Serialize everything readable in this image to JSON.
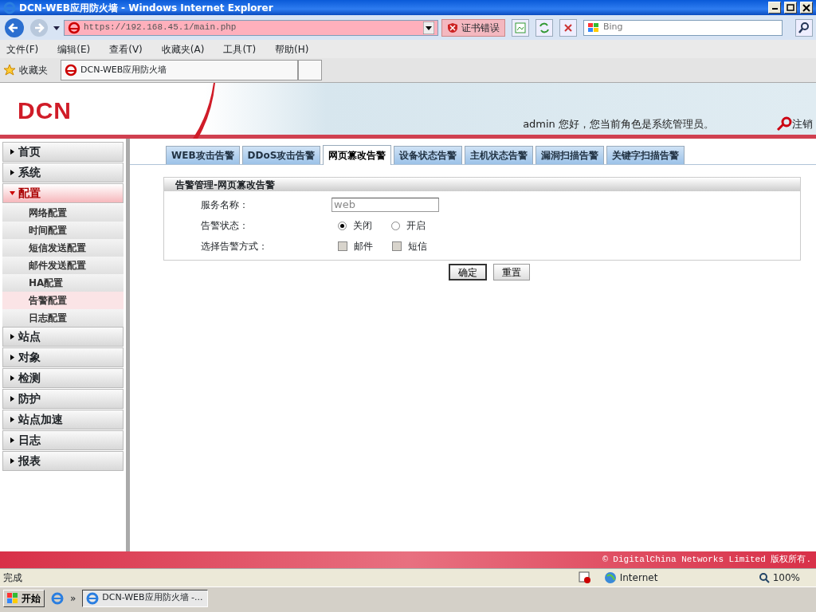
{
  "window": {
    "title": "DCN-WEB应用防火墙 - Windows Internet Explorer"
  },
  "browser": {
    "address": "https://192.168.45.1/main.php",
    "cert_error": "证书错误",
    "search": {
      "placeholder": "Bing"
    },
    "menu": [
      "文件(F)",
      "编辑(E)",
      "查看(V)",
      "收藏夹(A)",
      "工具(T)",
      "帮助(H)"
    ],
    "favorites": "收藏夹",
    "tab": "DCN-WEB应用防火墙"
  },
  "header": {
    "logo": "DCN",
    "greeting": "admin 您好，您当前角色是系统管理员。",
    "logout": "注销"
  },
  "sidebar": {
    "items": [
      {
        "label": "首页",
        "expanded": false
      },
      {
        "label": "系统",
        "expanded": false
      },
      {
        "label": "配置",
        "expanded": true,
        "children": [
          {
            "label": "网络配置",
            "selected": false
          },
          {
            "label": "时间配置",
            "selected": false
          },
          {
            "label": "短信发送配置",
            "selected": false
          },
          {
            "label": "邮件发送配置",
            "selected": false
          },
          {
            "label": "HA配置",
            "selected": false
          },
          {
            "label": "告警配置",
            "selected": true
          },
          {
            "label": "日志配置",
            "selected": false
          }
        ]
      },
      {
        "label": "站点",
        "expanded": false
      },
      {
        "label": "对象",
        "expanded": false
      },
      {
        "label": "检测",
        "expanded": false
      },
      {
        "label": "防护",
        "expanded": false
      },
      {
        "label": "站点加速",
        "expanded": false
      },
      {
        "label": "日志",
        "expanded": false
      },
      {
        "label": "报表",
        "expanded": false
      }
    ]
  },
  "tabs": [
    {
      "label": "WEB攻击告警",
      "selected": false
    },
    {
      "label": "DDoS攻击告警",
      "selected": false
    },
    {
      "label": "网页篡改告警",
      "selected": true
    },
    {
      "label": "设备状态告警",
      "selected": false
    },
    {
      "label": "主机状态告警",
      "selected": false
    },
    {
      "label": "漏洞扫描告警",
      "selected": false
    },
    {
      "label": "关键字扫描告警",
      "selected": false
    }
  ],
  "form": {
    "title": "告警管理-网页篡改告警",
    "fields": [
      {
        "kind": "text",
        "label": "服务名称：",
        "value": "web"
      },
      {
        "kind": "radio",
        "label": "告警状态：",
        "options": [
          {
            "label": "关闭",
            "selected": true
          },
          {
            "label": "开启",
            "selected": false
          }
        ]
      },
      {
        "kind": "checkbox",
        "label": "选择告警方式：",
        "options": [
          {
            "label": "邮件",
            "checked": false,
            "disabled": true
          },
          {
            "label": "短信",
            "checked": false,
            "disabled": true
          }
        ]
      }
    ],
    "buttons": [
      "确定",
      "重置"
    ]
  },
  "footer": "© DigitalChina Networks Limited 版权所有.",
  "status_bar": {
    "text": "完成",
    "zone": "Internet",
    "zoom": "100%"
  },
  "taskbar": {
    "start": "开始",
    "more": "»",
    "task": "DCN-WEB应用防火墙 -..."
  }
}
